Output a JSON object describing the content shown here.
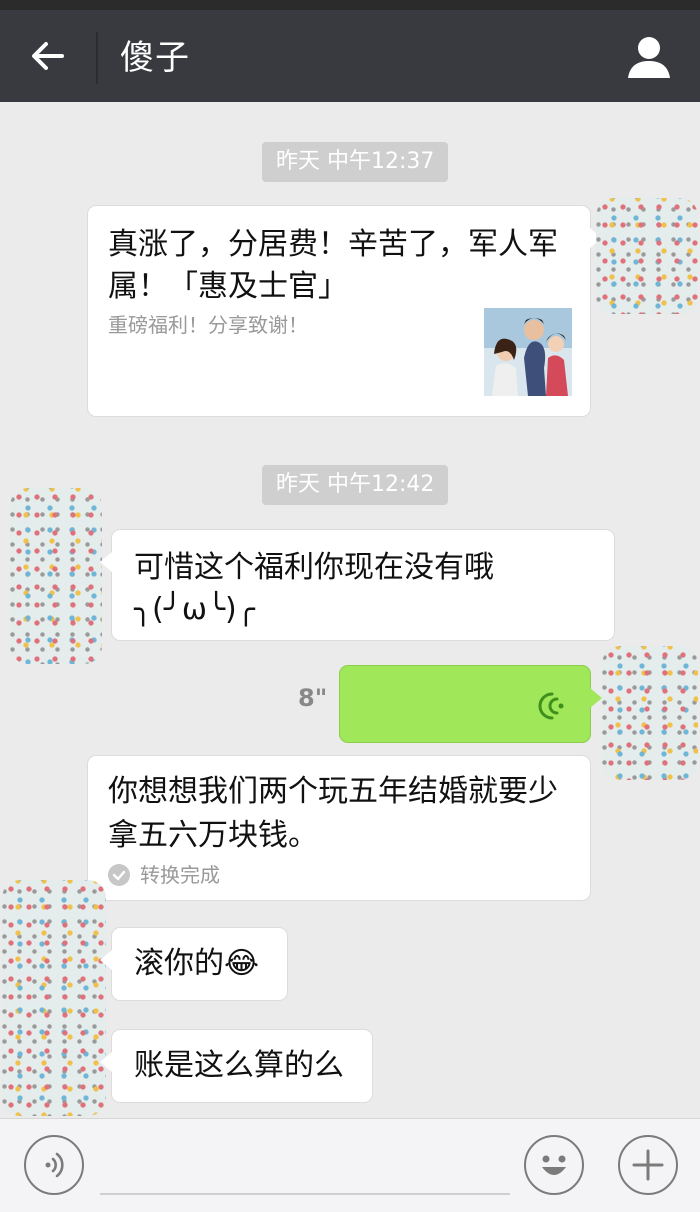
{
  "header": {
    "title": "傻子"
  },
  "messages": {
    "ts1": "昨天 中午12:37",
    "link": {
      "title": "真涨了，分居费！辛苦了，军人军属！「惠及士官」",
      "description": "重磅福利！分享致谢！"
    },
    "ts2": "昨天 中午12:42",
    "m1_line1": "可惜这个福利你现在没有哦",
    "m1_line2": "╮(╯ω╰)╭",
    "voice_duration": "8\"",
    "m2": "你想想我们两个玩五年结婚就要少拿五六万块钱。",
    "m2_status": "转换完成",
    "m3": "滚你的😂",
    "m4": "账是这么算的么"
  },
  "colors": {
    "topbar": "#393a3f",
    "voice_bubble": "#a0e75a",
    "background": "#ebebeb"
  }
}
